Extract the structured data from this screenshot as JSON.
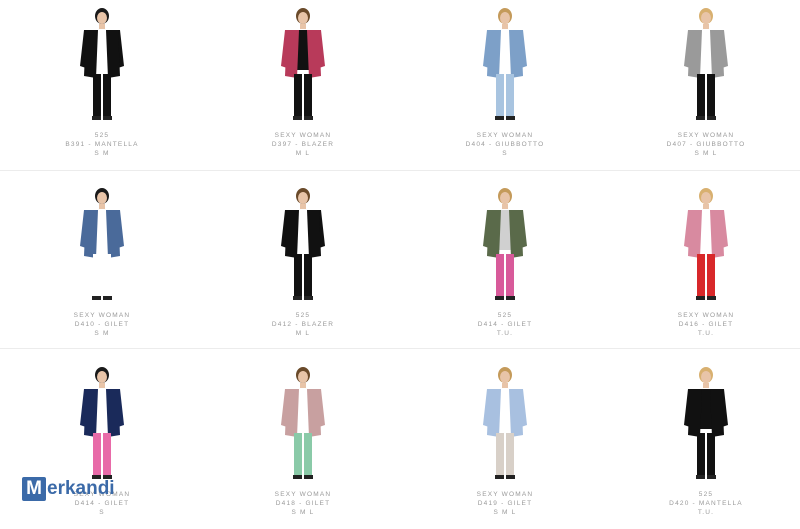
{
  "products": [
    {
      "brand": "525",
      "code": "B391 - MANTELLA",
      "sizes": "S M",
      "icon": "cape-outfit-icon"
    },
    {
      "brand": "SEXY WOMAN",
      "code": "D397 - BLAZER",
      "sizes": "M L",
      "icon": "blazer-outfit-icon"
    },
    {
      "brand": "SEXY WOMAN",
      "code": "D404 - GIUBBOTTO",
      "sizes": "S",
      "icon": "denim-jacket-outfit-icon"
    },
    {
      "brand": "SEXY WOMAN",
      "code": "D407 - GIUBBOTTO",
      "sizes": "S M L",
      "icon": "coat-outfit-icon"
    },
    {
      "brand": "SEXY WOMAN",
      "code": "D410 - GILET",
      "sizes": "S M",
      "icon": "denim-vest-outfit-icon"
    },
    {
      "brand": "525",
      "code": "D412 - BLAZER",
      "sizes": "M L",
      "icon": "blazer-outfit-icon"
    },
    {
      "brand": "525",
      "code": "D414 - GILET",
      "sizes": "T.U.",
      "icon": "vest-outfit-icon"
    },
    {
      "brand": "SEXY WOMAN",
      "code": "D416 - GILET",
      "sizes": "T.U.",
      "icon": "vest-outfit-icon"
    },
    {
      "brand": "SEXY WOMAN",
      "code": "D414 - GILET",
      "sizes": "S",
      "icon": "vest-outfit-icon"
    },
    {
      "brand": "SEXY WOMAN",
      "code": "D418 - GILET",
      "sizes": "S M L",
      "icon": "vest-outfit-icon"
    },
    {
      "brand": "SEXY WOMAN",
      "code": "D419 - GILET",
      "sizes": "S M L",
      "icon": "vest-outfit-icon"
    },
    {
      "brand": "525",
      "code": "D420 - MANTELLA",
      "sizes": "T.U.",
      "icon": "cape-outfit-icon"
    }
  ],
  "colors": {
    "skin": "#e8c4a8",
    "hair": [
      "#1a1a1a",
      "#6a4a2a",
      "#c49a5a",
      "#d8b070"
    ],
    "garments": [
      [
        "#111111",
        "#ffffff",
        "#111111",
        "#111111"
      ],
      [
        "#b83a5a",
        "#111111",
        "#111111",
        "#111111"
      ],
      [
        "#7da0c8",
        "#ffffff",
        "#a8c4e0",
        "#a8c4e0"
      ],
      [
        "#9a9a9a",
        "#ffffff",
        "#111111",
        "#111111"
      ],
      [
        "#4a6a9a",
        "#ffffff",
        "#ffffff",
        "#ffffff"
      ],
      [
        "#111111",
        "#ffffff",
        "#111111",
        "#111111"
      ],
      [
        "#5a6a4a",
        "#d0d0d0",
        "#d85a9a",
        "#d85a9a"
      ],
      [
        "#d88aa0",
        "#ffffff",
        "#d8282a",
        "#d8282a"
      ],
      [
        "#1a2a5a",
        "#ffffff",
        "#e86aa8",
        "#e86aa8"
      ],
      [
        "#c8a0a0",
        "#ffffff",
        "#8acaa8",
        "#8acaa8"
      ],
      [
        "#a8c0e0",
        "#ffffff",
        "#d8d0c8",
        "#d8d0c8"
      ],
      [
        "#111111",
        "#111111",
        "#111111",
        "#111111"
      ]
    ]
  },
  "logo": {
    "first": "M",
    "rest": "erkandi"
  }
}
